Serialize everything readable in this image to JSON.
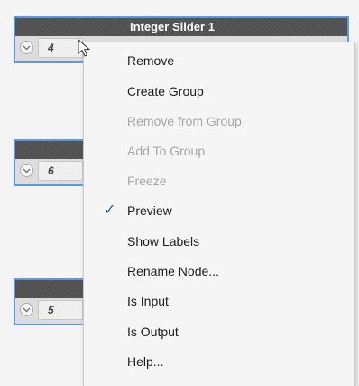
{
  "nodes": [
    {
      "title": "Integer Slider 1",
      "value": "4"
    },
    {
      "title": "",
      "value": "6"
    },
    {
      "title": "",
      "value": "5"
    }
  ],
  "context_menu": {
    "items": [
      {
        "label": "Remove",
        "enabled": true,
        "checked": false
      },
      {
        "label": "Create Group",
        "enabled": true,
        "checked": false
      },
      {
        "label": "Remove from Group",
        "enabled": false,
        "checked": false
      },
      {
        "label": "Add To Group",
        "enabled": false,
        "checked": false
      },
      {
        "label": "Freeze",
        "enabled": false,
        "checked": false
      },
      {
        "label": "Preview",
        "enabled": true,
        "checked": true
      },
      {
        "label": "Show Labels",
        "enabled": true,
        "checked": false
      },
      {
        "label": "Rename Node...",
        "enabled": true,
        "checked": false
      },
      {
        "label": "Is Input",
        "enabled": true,
        "checked": false
      },
      {
        "label": "Is Output",
        "enabled": true,
        "checked": false
      },
      {
        "label": "Help...",
        "enabled": true,
        "checked": false
      }
    ],
    "check_glyph": "✓"
  },
  "icons": {
    "expand": "chevron-down-icon",
    "cursor": "mouse-pointer-icon",
    "check": "check-icon"
  },
  "colors": {
    "accent": "#5a9be0",
    "header": "#4f4f4f",
    "disabled_text": "#a7a7a7",
    "check": "#2a5db0"
  }
}
